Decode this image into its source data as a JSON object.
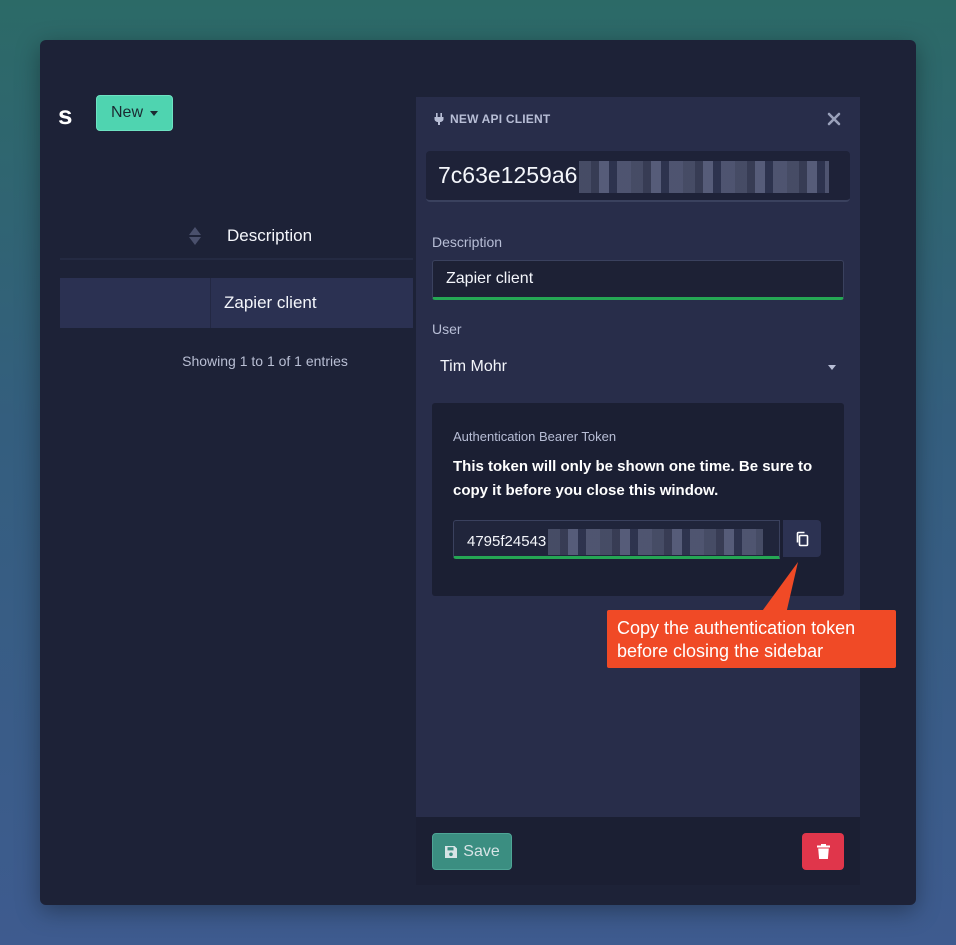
{
  "table": {
    "page_letter": "s",
    "new_button_label": "New",
    "column_header": "Description",
    "rows": [
      {
        "description": "Zapier client"
      }
    ],
    "footer_info": "Showing 1 to 1 of 1 entries"
  },
  "sidebar": {
    "header": "NEW API CLIENT",
    "client_id_visible": "7c63e1259a6",
    "description_label": "Description",
    "description_value": "Zapier client",
    "user_label": "User",
    "user_value": "Tim Mohr",
    "token": {
      "label": "Authentication Bearer Token",
      "warning": "This token will only be shown one time. Be sure to copy it before you close this window.",
      "value_visible": "4795f24543"
    },
    "save_label": "Save"
  },
  "annotation": {
    "line1": "Copy the authentication token",
    "line2": "before closing the sidebar"
  },
  "colors": {
    "accent": "#4fd4b0",
    "panel": "#282d4a",
    "window": "#1d2237",
    "success_underline": "#25a754",
    "danger": "#e0364b",
    "annotation": "#f04a26"
  }
}
